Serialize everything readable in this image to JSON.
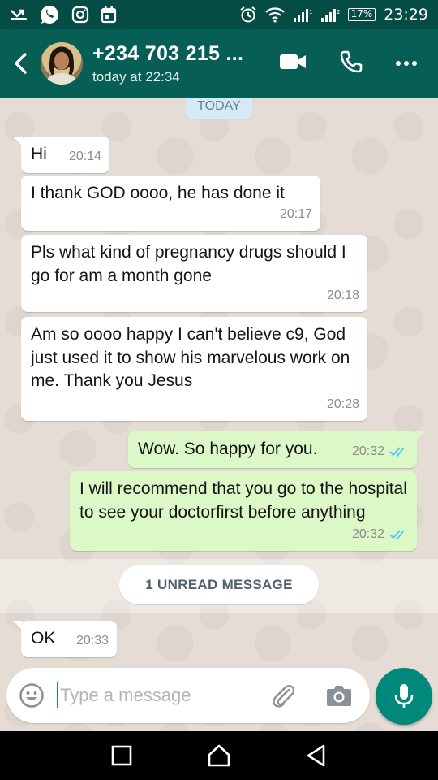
{
  "status_bar": {
    "battery": "17%",
    "time": "23:29"
  },
  "header": {
    "contact_name": "+234 703 215 ...",
    "contact_status": "today at 22:34"
  },
  "chat": {
    "date_label": "TODAY",
    "messages": [
      {
        "direction": "in",
        "text": "Hi",
        "time": "20:14"
      },
      {
        "direction": "in",
        "text": "I thank GOD oooo, he has done it",
        "time": "20:17"
      },
      {
        "direction": "in",
        "text": "Pls what kind of pregnancy drugs should I go for am a month gone",
        "time": "20:18"
      },
      {
        "direction": "in",
        "text": "Am so oooo happy I can't believe c9, God just used it to show his marvelous work on  me. Thank you Jesus",
        "time": "20:28"
      },
      {
        "direction": "out",
        "text": "Wow. So happy for you.",
        "time": "20:32",
        "read": true
      },
      {
        "direction": "out",
        "text": "I will recommend that you go to the hospital to see your doctorfirst before anything",
        "time": "20:32",
        "read": true
      },
      {
        "direction": "in",
        "text": "OK",
        "time": "20:33"
      }
    ],
    "unread_label": "1 UNREAD MESSAGE"
  },
  "composer": {
    "placeholder": "Type a message",
    "value": ""
  },
  "colors": {
    "header": "#075e54",
    "status_bar": "#054d44",
    "outgoing_bubble": "#dcf8c6",
    "incoming_bubble": "#ffffff",
    "read_ticks": "#4fc3f7",
    "fab": "#00897b"
  },
  "icons": [
    "missed-call-icon",
    "whatsapp-icon",
    "instagram-icon",
    "calendar-icon",
    "alarm-icon",
    "wifi-icon",
    "signal-icon",
    "back-arrow-icon",
    "video-call-icon",
    "voice-call-icon",
    "more-menu-icon",
    "emoji-icon",
    "attach-icon",
    "camera-icon",
    "mic-icon",
    "recent-apps-icon",
    "home-icon",
    "back-nav-icon"
  ]
}
